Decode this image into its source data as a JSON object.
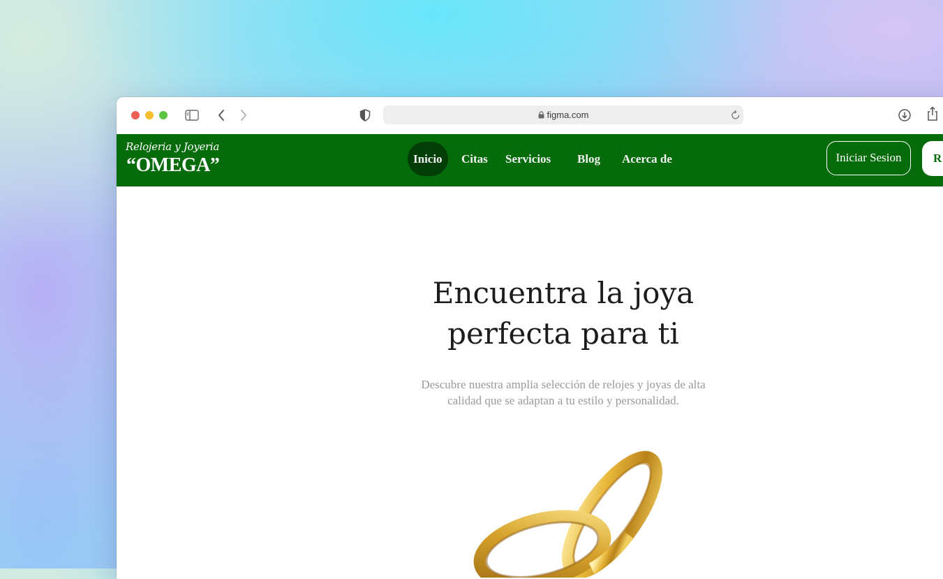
{
  "browser": {
    "url": "figma.com"
  },
  "site": {
    "logo_script": "Relojeria y Joyeria",
    "logo_main": "“OMEGA”",
    "nav": [
      {
        "label": "Inicio",
        "active": true
      },
      {
        "label": "Citas",
        "active": false
      },
      {
        "label": "Servicios",
        "active": false
      },
      {
        "label": "Blog",
        "active": false
      },
      {
        "label": "Acerca de",
        "active": false
      }
    ],
    "login_label": "Iniciar Sesion",
    "register_label": "R",
    "colors": {
      "nav_bg": "#066b0b",
      "active_pill": "#033e06",
      "ring_gold": "#e3b53b"
    }
  },
  "hero": {
    "title_line1": "Encuentra la joya",
    "title_line2": "perfecta para ti",
    "subtitle_line1": "Descubre nuestra amplia selección de relojes y joyas de alta",
    "subtitle_line2": "calidad que se adaptan a tu estilo y personalidad.",
    "image": "gold-wedding-rings"
  }
}
